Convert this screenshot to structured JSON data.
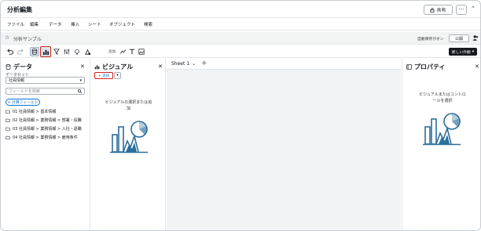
{
  "app": {
    "title": "分析編集",
    "share_label": "共有",
    "more_label": "···",
    "chevron_label": "⌃"
  },
  "menu": {
    "items": [
      "ファイル",
      "編集",
      "データ",
      "挿入",
      "シート",
      "オブジェクト",
      "検索"
    ]
  },
  "analysis": {
    "name": "分析サンプル",
    "autosave": "自動保存がオン",
    "publish_label": "公開"
  },
  "toolbar": {
    "add_label": "追加",
    "new_sheet_label": "新しい外観"
  },
  "data_panel": {
    "title": "データ",
    "dataset_label": "データセット",
    "dataset_value": "社員情報",
    "search_placeholder": "フィールドを検索",
    "calc_field_label": "+ 計算フィールド",
    "folders": [
      "01 社員情報 > 基本情報",
      "02 社員情報 > 業務情報 > 部署・役職",
      "03 社員情報 > 業務情報 > 入社・退職",
      "04 社員情報 > 業務情報 > 雇用条件"
    ]
  },
  "visual_panel": {
    "title": "ビジュアル",
    "add_label": "+ 追加",
    "empty_text_1": "ビジュアルの選択または追",
    "empty_text_2": "加"
  },
  "sheets": {
    "tabs": [
      {
        "label": "Sheet 1"
      }
    ],
    "add_label": "+"
  },
  "properties_panel": {
    "title": "プロパティ",
    "empty_text_1": "ビジュアルまたはコントロ",
    "empty_text_2": "ールを選択"
  },
  "colors": {
    "accent": "#0972d3",
    "highlight_red": "#d0211c",
    "illustration": "#2c6e9b"
  }
}
